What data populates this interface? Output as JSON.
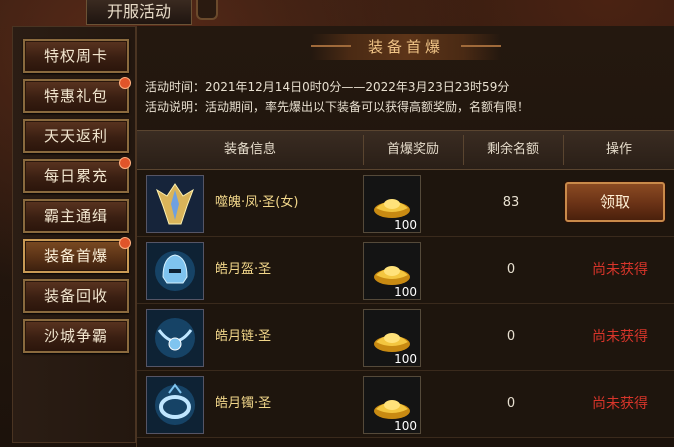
{
  "window": {
    "title": "开服活动"
  },
  "sidebar": {
    "items": [
      {
        "label": "特权周卡",
        "badge": false,
        "active": false
      },
      {
        "label": "特惠礼包",
        "badge": true,
        "active": false
      },
      {
        "label": "天天返利",
        "badge": false,
        "active": false
      },
      {
        "label": "每日累充",
        "badge": true,
        "active": false
      },
      {
        "label": "霸主通缉",
        "badge": false,
        "active": false
      },
      {
        "label": "装备首爆",
        "badge": true,
        "active": true
      },
      {
        "label": "装备回收",
        "badge": false,
        "active": false
      },
      {
        "label": "沙城争霸",
        "badge": false,
        "active": false
      }
    ]
  },
  "main": {
    "banner": "装备首爆",
    "time_text": "活动时间：2021年12月14日0时0分——2022年3月23日23时59分",
    "desc_text": "活动说明：活动期间，率先爆出以下装备可以获得高额奖励，名额有限！",
    "columns": [
      "装备信息",
      "首爆奖励",
      "剩余名额",
      "操作"
    ],
    "rows": [
      {
        "item": "噬魄·凤·圣(女)",
        "item_icon": "phoenix-armor-icon",
        "reward_icon": "gold-ingot-icon",
        "reward_qty": "100",
        "remaining": "83",
        "action": "领取",
        "claimable": true
      },
      {
        "item": "皓月盔·圣",
        "item_icon": "helmet-icon",
        "reward_icon": "gold-ingot-icon",
        "reward_qty": "100",
        "remaining": "0",
        "action": "尚未获得",
        "claimable": false
      },
      {
        "item": "皓月链·圣",
        "item_icon": "necklace-icon",
        "reward_icon": "gold-ingot-icon",
        "reward_qty": "100",
        "remaining": "0",
        "action": "尚未获得",
        "claimable": false
      },
      {
        "item": "皓月镯·圣",
        "item_icon": "bracelet-icon",
        "reward_icon": "gold-ingot-icon",
        "reward_qty": "100",
        "remaining": "0",
        "action": "尚未获得",
        "claimable": false
      }
    ]
  },
  "colors": {
    "accent": "#f0c487",
    "item_name": "#f1d68a",
    "status_red": "#d8352a"
  }
}
